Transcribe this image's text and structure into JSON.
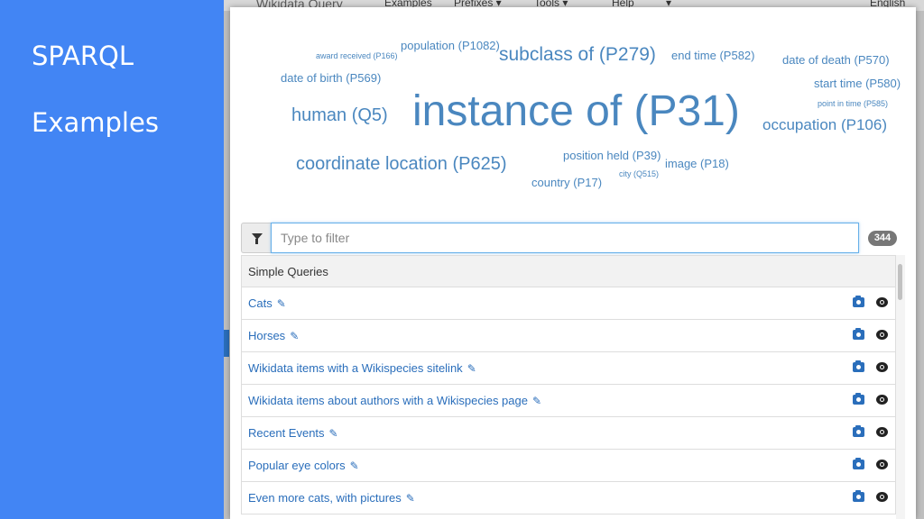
{
  "slide": {
    "title": "SPARQL",
    "subtitle": "Examples"
  },
  "background_app": {
    "brand": "Wikidata Query",
    "nav": [
      "Examples",
      "Prefixes ▾",
      "Tools ▾",
      "Help",
      "▾",
      "English"
    ]
  },
  "word_cloud": [
    {
      "text": "award received (P166)",
      "size": 9
    },
    {
      "text": "population (P1082)",
      "size": 13
    },
    {
      "text": "subclass of (P279)",
      "size": 21
    },
    {
      "text": "end time (P582)",
      "size": 13
    },
    {
      "text": "date of death (P570)",
      "size": 13
    },
    {
      "text": "date of birth (P569)",
      "size": 13
    },
    {
      "text": "start time (P580)",
      "size": 13
    },
    {
      "text": "point in time (P585)",
      "size": 9
    },
    {
      "text": "human (Q5)",
      "size": 20
    },
    {
      "text": "instance of (P31)",
      "size": 48
    },
    {
      "text": "occupation (P106)",
      "size": 17
    },
    {
      "text": "position held (P39)",
      "size": 13
    },
    {
      "text": "image (P18)",
      "size": 13
    },
    {
      "text": "coordinate location (P625)",
      "size": 20
    },
    {
      "text": "city (Q515)",
      "size": 9
    },
    {
      "text": "country (P17)",
      "size": 13
    }
  ],
  "filter": {
    "placeholder": "Type to filter",
    "count": "344",
    "icon": "filter-icon"
  },
  "list": {
    "header": "Simple Queries",
    "items": [
      {
        "label": "Cats"
      },
      {
        "label": "Horses"
      },
      {
        "label": "Wikidata items with a Wikispecies sitelink"
      },
      {
        "label": "Wikidata items about authors with a Wikispecies page"
      },
      {
        "label": "Recent Events"
      },
      {
        "label": "Popular eye colors"
      },
      {
        "label": "Even more cats, with pictures"
      }
    ]
  },
  "colors": {
    "slide_bg": "#4285f4",
    "link": "#2a6ebb",
    "cloud": "#4a87bf"
  }
}
